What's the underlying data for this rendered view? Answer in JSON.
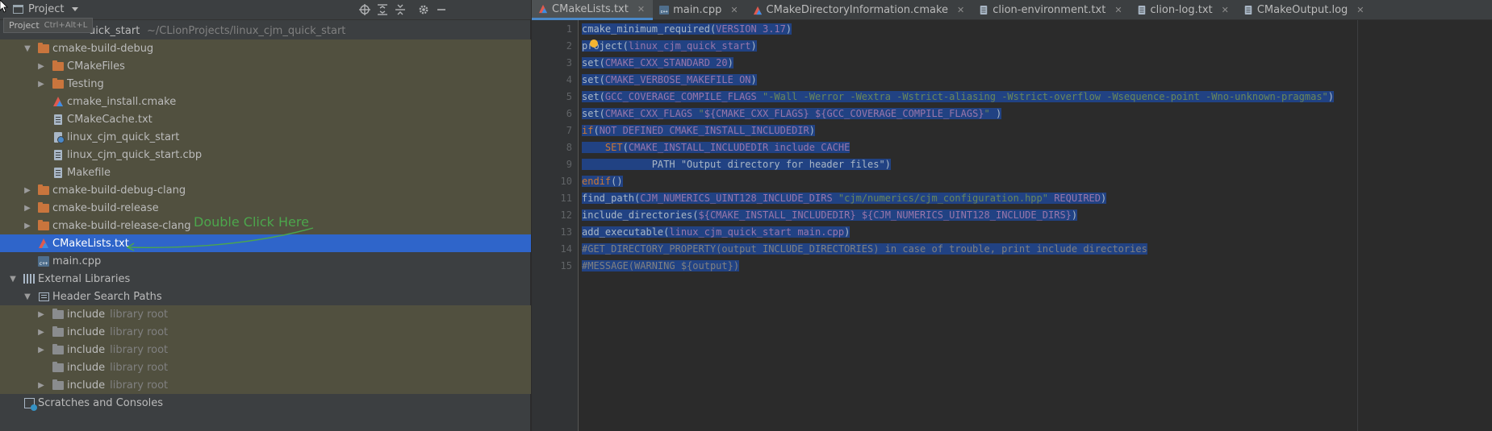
{
  "tool_window": {
    "title": "Project",
    "tooltip_label": "Project",
    "tooltip_shortcut": "Ctrl+Alt+L"
  },
  "tree": {
    "root_name": "uick_start",
    "root_path": "~/CLionProjects/linux_cjm_quick_start",
    "items": [
      {
        "label": "cmake-build-debug",
        "hint": ""
      },
      {
        "label": "CMakeFiles",
        "hint": ""
      },
      {
        "label": "Testing",
        "hint": ""
      },
      {
        "label": "cmake_install.cmake",
        "hint": ""
      },
      {
        "label": "CMakeCache.txt",
        "hint": ""
      },
      {
        "label": "linux_cjm_quick_start",
        "hint": ""
      },
      {
        "label": "linux_cjm_quick_start.cbp",
        "hint": ""
      },
      {
        "label": "Makefile",
        "hint": ""
      },
      {
        "label": "cmake-build-debug-clang",
        "hint": ""
      },
      {
        "label": "cmake-build-release",
        "hint": ""
      },
      {
        "label": "cmake-build-release-clang",
        "hint": ""
      },
      {
        "label": "CMakeLists.txt",
        "hint": ""
      },
      {
        "label": "main.cpp",
        "hint": ""
      },
      {
        "label": "External Libraries",
        "hint": ""
      },
      {
        "label": "Header Search Paths",
        "hint": ""
      },
      {
        "label": "include",
        "hint": "library root"
      },
      {
        "label": "include",
        "hint": "library root"
      },
      {
        "label": "include",
        "hint": "library root"
      },
      {
        "label": "include",
        "hint": "library root"
      },
      {
        "label": "include",
        "hint": "library root"
      },
      {
        "label": "Scratches and Consoles",
        "hint": ""
      }
    ]
  },
  "annotation": {
    "text": "Double Click Here",
    "color": "#4ca64c"
  },
  "tabs": [
    {
      "label": "CMakeLists.txt",
      "icon": "cmake-icon",
      "active": true
    },
    {
      "label": "main.cpp",
      "icon": "cpp-file-icon",
      "active": false
    },
    {
      "label": "CMakeDirectoryInformation.cmake",
      "icon": "cmake-icon",
      "active": false
    },
    {
      "label": "clion-environment.txt",
      "icon": "text-file-icon",
      "active": false
    },
    {
      "label": "clion-log.txt",
      "icon": "text-file-icon",
      "active": false
    },
    {
      "label": "CMakeOutput.log",
      "icon": "text-file-icon",
      "active": false
    }
  ],
  "editor": {
    "line_numbers": [
      "1",
      "2",
      "3",
      "4",
      "5",
      "6",
      "7",
      "8",
      "9",
      "10",
      "11",
      "12",
      "13",
      "14",
      "15"
    ],
    "lines": [
      "cmake_minimum_required(VERSION 3.17)",
      "project(linux_cjm_quick_start)",
      "set(CMAKE_CXX_STANDARD 20)",
      "set(CMAKE_VERBOSE_MAKEFILE ON)",
      "set(GCC_COVERAGE_COMPILE_FLAGS \"-Wall -Werror -Wextra -Wstrict-aliasing -Wstrict-overflow -Wsequence-point -Wno-unknown-pragmas\")",
      "set(CMAKE_CXX_FLAGS \"${CMAKE_CXX_FLAGS} ${GCC_COVERAGE_COMPILE_FLAGS}\" )",
      "if(NOT DEFINED CMAKE_INSTALL_INCLUDEDIR)",
      "    SET(CMAKE_INSTALL_INCLUDEDIR include CACHE",
      "            PATH \"Output directory for header files\")",
      "endif()",
      "find_path(CJM_NUMERICS_UINT128_INCLUDE_DIRS \"cjm/numerics/cjm_configuration.hpp\" REQUIRED)",
      "include_directories(${CMAKE_INSTALL_INCLUDEDIR} ${CJM_NUMERICS_UINT128_INCLUDE_DIRS})",
      "add_executable(linux_cjm_quick_start main.cpp)",
      "#GET_DIRECTORY_PROPERTY(output INCLUDE_DIRECTORIES) in case of trouble, print include directories",
      "#MESSAGE(WARNING ${output})"
    ]
  },
  "colors": {
    "selection": "#214283",
    "tree_selected": "#2f65ca",
    "tree_highlight": "#51503f",
    "keyword": "#cc7832",
    "variable": "#9876aa",
    "string": "#6a8759",
    "comment": "#808080"
  }
}
